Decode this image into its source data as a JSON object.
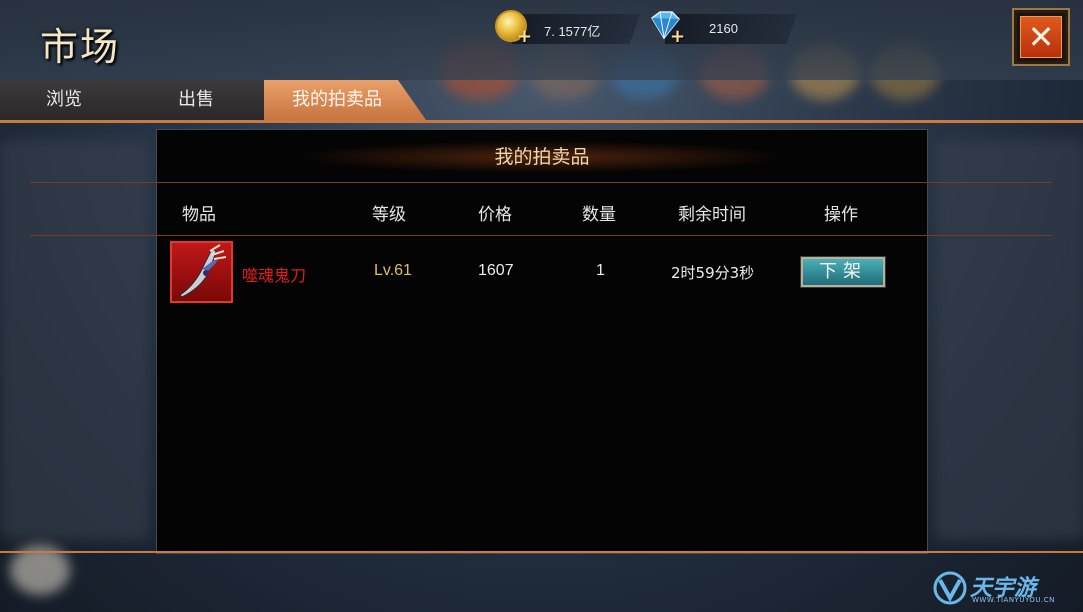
{
  "header": {
    "title": "市场",
    "gold_value": "7. 1577亿",
    "gem_value": "2160"
  },
  "tabs": [
    {
      "label": "浏览",
      "active": false
    },
    {
      "label": "出售",
      "active": false
    },
    {
      "label": "我的拍卖品",
      "active": true
    }
  ],
  "panel": {
    "title": "我的拍卖品",
    "columns": [
      "物品",
      "等级",
      "价格",
      "数量",
      "剩余时间",
      "操作"
    ],
    "rows": [
      {
        "item_name": "噬魂鬼刀",
        "level": "Lv.61",
        "price": "1607",
        "quantity": "1",
        "time_left": "2时59分3秒",
        "action_label": "下架",
        "icon": "sword-icon"
      }
    ]
  },
  "colors": {
    "accent": "#c87a40",
    "active_tab": "#e9a06a",
    "item_name": "#e21c1c",
    "level_text": "#e0c050",
    "button": "#2f8c96"
  },
  "watermark": {
    "text": "天宇游",
    "sub": "WWW.TIANYUYOU.CN"
  }
}
